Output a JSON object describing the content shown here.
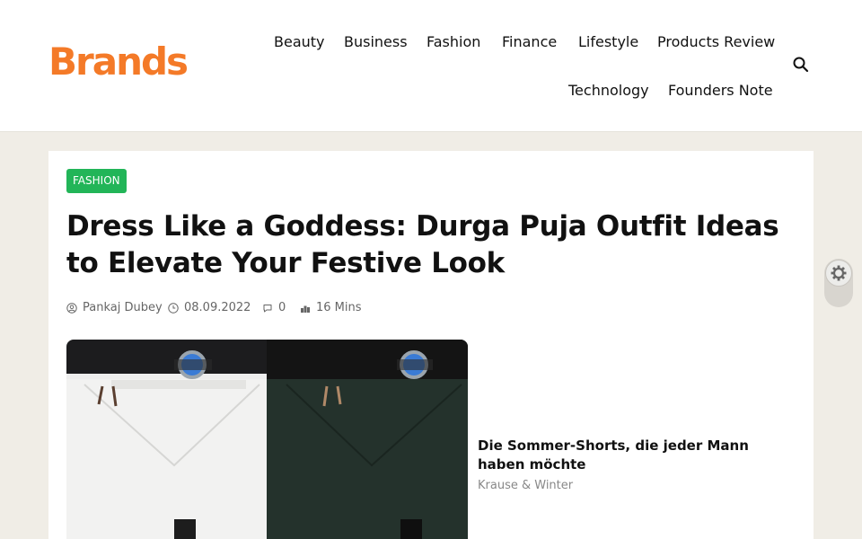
{
  "header": {
    "logo": "Brands",
    "nav": [
      "Beauty",
      "Business",
      "Fashion",
      "Finance",
      "Lifestyle",
      "Products Review",
      "Technology",
      "Founders Note"
    ]
  },
  "article": {
    "category": "FASHION",
    "title": "Dress Like a Goddess: Durga Puja Outfit Ideas to Elevate Your Festive Look",
    "meta": {
      "author": "Pankaj Dubey",
      "date": "08.09.2022",
      "comments": "0",
      "read_time": "16 Mins"
    }
  },
  "ad": {
    "title": "Die Sommer-Shorts, die jeder Mann haben möchte",
    "source": "Krause & Winter"
  },
  "colors": {
    "brand": "#f47a28",
    "category_badge": "#22b558",
    "page_bg": "#f0ede6"
  }
}
